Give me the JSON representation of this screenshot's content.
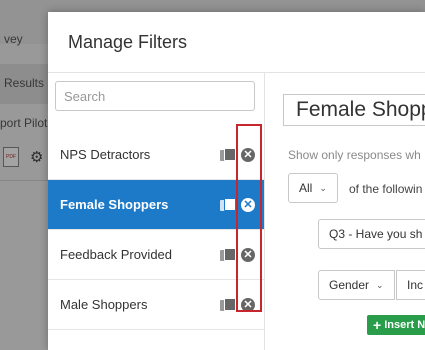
{
  "background": {
    "nav_items": [
      "vey",
      "Results",
      "port Pilot"
    ]
  },
  "modal": {
    "title": "Manage Filters",
    "search_placeholder": "Search",
    "filters": [
      {
        "label": "NPS Detractors",
        "active": false
      },
      {
        "label": "Female Shoppers",
        "active": true
      },
      {
        "label": "Feedback Provided",
        "active": false
      },
      {
        "label": "Male Shoppers",
        "active": false
      }
    ],
    "editor": {
      "filter_name": "Female Shopp",
      "description": "Show only responses wh",
      "match_select": "All",
      "of_text": "of the followin",
      "question_select": "Q3 - Have you sh",
      "field_select": "Gender",
      "operator_select": "Inc",
      "insert_button": "Insert New Cond"
    }
  },
  "colors": {
    "active_blue": "#1c7ac9",
    "highlight_red": "#c8262e",
    "insert_green": "#2a9d4a"
  }
}
